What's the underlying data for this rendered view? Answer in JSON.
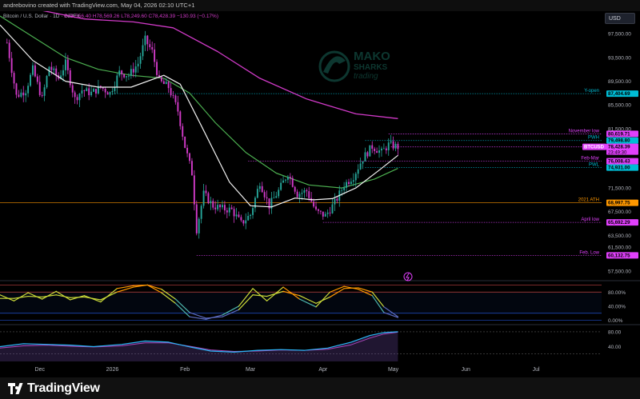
{
  "header": {
    "title": "andrebovino created with TradingView.com, May 04, 2026 02:10 UTC+1",
    "symbol_line": "Bitcoin / U.S. Dollar · 1D · INDEX",
    "ohlc": "O78,556.40 H78,569.26 L78,249.60 C78,428.39 −130.93 (−0.17%)"
  },
  "currency_button": "USD",
  "footer": {
    "brand": "TradingView"
  },
  "watermark": {
    "line1": "MAKO",
    "line2": "SHARKS",
    "line3": "trading"
  },
  "colors": {
    "up": "#26a69a",
    "down": "#d13ac8",
    "sma_fast": "#f2f2f2",
    "sma_mid": "#4caf50",
    "sma_slow": "#d13ac8",
    "level_cyan": "#00bcd4",
    "level_magenta": "#e040fb",
    "level_orange": "#ff9800"
  },
  "chart_data": [
    {
      "type": "candlestick",
      "x_labels": [
        "Dec",
        "2026",
        "Feb",
        "Mar",
        "Apr",
        "May",
        "Jun",
        "Jul"
      ],
      "x_label_dates": [
        "2025-12-01",
        "2026-01-01",
        "2026-02-01",
        "2026-03-01",
        "2026-04-01",
        "2026-05-01",
        "2026-06-01",
        "2026-07-01"
      ],
      "x_range": [
        "2025-11-14",
        "2026-07-29"
      ],
      "ylim": [
        56000,
        100500
      ],
      "y_ticks": [
        "97,500.00",
        "93,500.00",
        "89,500.00",
        "85,500.00",
        "81,500.00",
        "77,500.00",
        "75,500.00",
        "71,500.00",
        "67,500.00",
        "63,500.00",
        "61,500.00",
        "57,500.00"
      ],
      "y_tick_values": [
        97500,
        93500,
        89500,
        85500,
        81500,
        77500,
        75500,
        71500,
        67500,
        63500,
        61500,
        57500
      ],
      "price_path": [
        [
          "2025-11-17",
          96000
        ],
        [
          "2025-11-21",
          87000
        ],
        [
          "2025-11-25",
          88000
        ],
        [
          "2025-11-28",
          91500
        ],
        [
          "2025-12-02",
          86500
        ],
        [
          "2025-12-05",
          92000
        ],
        [
          "2025-12-09",
          90000
        ],
        [
          "2025-12-12",
          92500
        ],
        [
          "2025-12-16",
          86500
        ],
        [
          "2025-12-19",
          88000
        ],
        [
          "2025-12-23",
          87500
        ],
        [
          "2025-12-27",
          88500
        ],
        [
          "2025-12-31",
          87500
        ],
        [
          "2026-01-04",
          91000
        ],
        [
          "2026-01-08",
          90500
        ],
        [
          "2026-01-12",
          92500
        ],
        [
          "2026-01-15",
          96500
        ],
        [
          "2026-01-18",
          94500
        ],
        [
          "2026-01-21",
          89500
        ],
        [
          "2026-01-25",
          88500
        ],
        [
          "2026-01-29",
          84500
        ],
        [
          "2026-02-01",
          78500
        ],
        [
          "2026-02-04",
          74000
        ],
        [
          "2026-02-06",
          64500
        ],
        [
          "2026-02-09",
          70500
        ],
        [
          "2026-02-13",
          68500
        ],
        [
          "2026-02-17",
          68000
        ],
        [
          "2026-02-21",
          67800
        ],
        [
          "2026-02-25",
          65500
        ],
        [
          "2026-03-01",
          67000
        ],
        [
          "2026-03-05",
          72500
        ],
        [
          "2026-03-09",
          68500
        ],
        [
          "2026-03-13",
          71000
        ],
        [
          "2026-03-17",
          74000
        ],
        [
          "2026-03-21",
          70500
        ],
        [
          "2026-03-25",
          71000
        ],
        [
          "2026-03-29",
          67500
        ],
        [
          "2026-04-02",
          66800
        ],
        [
          "2026-04-06",
          69000
        ],
        [
          "2026-04-10",
          72000
        ],
        [
          "2026-04-14",
          73500
        ],
        [
          "2026-04-18",
          76500
        ],
        [
          "2026-04-22",
          78500
        ],
        [
          "2026-04-26",
          77500
        ],
        [
          "2026-04-29",
          78800
        ],
        [
          "2026-05-03",
          78428
        ]
      ],
      "sma_fast": [
        [
          "2025-11-14",
          99000
        ],
        [
          "2025-11-28",
          93000
        ],
        [
          "2025-12-12",
          89500
        ],
        [
          "2025-12-26",
          88500
        ],
        [
          "2026-01-09",
          88500
        ],
        [
          "2026-01-23",
          90500
        ],
        [
          "2026-01-30",
          89000
        ],
        [
          "2026-02-08",
          82000
        ],
        [
          "2026-02-20",
          72500
        ],
        [
          "2026-03-01",
          68500
        ],
        [
          "2026-03-10",
          68300
        ],
        [
          "2026-03-20",
          69800
        ],
        [
          "2026-03-28",
          69500
        ],
        [
          "2026-04-05",
          69700
        ],
        [
          "2026-04-15",
          71500
        ],
        [
          "2026-04-25",
          74500
        ],
        [
          "2026-05-03",
          77000
        ]
      ],
      "sma_mid": [
        [
          "2025-11-14",
          100500
        ],
        [
          "2025-11-28",
          97000
        ],
        [
          "2025-12-12",
          93500
        ],
        [
          "2025-12-26",
          91500
        ],
        [
          "2026-01-09",
          90500
        ],
        [
          "2026-01-23",
          90000
        ],
        [
          "2026-02-03",
          87500
        ],
        [
          "2026-02-14",
          82500
        ],
        [
          "2026-02-27",
          77500
        ],
        [
          "2026-03-12",
          74000
        ],
        [
          "2026-03-26",
          72000
        ],
        [
          "2026-04-09",
          71500
        ],
        [
          "2026-04-23",
          73000
        ],
        [
          "2026-05-03",
          74800
        ]
      ],
      "sma_slow": [
        [
          "2025-11-14",
          104500
        ],
        [
          "2025-12-01",
          101500
        ],
        [
          "2025-12-20",
          100000
        ],
        [
          "2026-01-10",
          99500
        ],
        [
          "2026-01-27",
          98500
        ],
        [
          "2026-02-15",
          94500
        ],
        [
          "2026-03-05",
          90000
        ],
        [
          "2026-03-25",
          86500
        ],
        [
          "2026-04-15",
          84000
        ],
        [
          "2026-05-03",
          83200
        ]
      ],
      "levels": [
        {
          "label": "Y-open",
          "value": 87404.69,
          "price": "87,404.69",
          "color": "#00bcd4",
          "from": "2026-01-01",
          "style": "dotted"
        },
        {
          "label": "November low",
          "value": 80619.71,
          "price": "80,619.71",
          "color": "#e040fb",
          "from": "2026-04-29",
          "style": "dotted"
        },
        {
          "label": "PWH",
          "value": 79498.8,
          "price": "79,498.80",
          "color": "#00bcd4",
          "from": "2026-04-19",
          "style": "dotted"
        },
        {
          "label": "BTCUSD",
          "value": 78428.39,
          "price": "78,428.39",
          "time": "23:49:30",
          "color": "#e040fb",
          "from": "2026-04-30",
          "style": "dotted"
        },
        {
          "label": "Feb-Mar",
          "value": 76008.43,
          "price": "76,008.43",
          "color": "#e040fb",
          "from": "2026-02-28",
          "style": "dotted"
        },
        {
          "label": "PWL",
          "value": 74931.0,
          "price": "74,931.00",
          "color": "#00bcd4",
          "from": "2026-04-19",
          "style": "dotted"
        },
        {
          "label": "2021 ATH",
          "value": 68997.75,
          "price": "68,997.75",
          "color": "#ff9800",
          "from": "2025-11-14",
          "style": "solid"
        },
        {
          "label": "April low",
          "value": 65692.29,
          "price": "65,692.29",
          "color": "#e040fb",
          "from": "2026-04-01",
          "style": "dotted"
        },
        {
          "label": "Feb. Low",
          "value": 60132.75,
          "price": "60,132.75",
          "color": "#e040fb",
          "from": "2026-02-06",
          "style": "dotted"
        }
      ]
    },
    {
      "type": "line",
      "name": "oscillator-1",
      "ylim": [
        -10,
        110
      ],
      "y_ticks": [
        "80.00%",
        "40.00%",
        "0.00%"
      ],
      "y_tick_values": [
        80,
        40,
        0
      ],
      "levels": [
        100,
        80,
        20,
        0
      ],
      "series_a": [
        [
          "2025-11-14",
          72
        ],
        [
          "2025-11-20",
          55
        ],
        [
          "2025-11-26",
          78
        ],
        [
          "2025-12-02",
          60
        ],
        [
          "2025-12-08",
          82
        ],
        [
          "2025-12-14",
          58
        ],
        [
          "2025-12-20",
          70
        ],
        [
          "2025-12-27",
          52
        ],
        [
          "2026-01-03",
          90
        ],
        [
          "2026-01-10",
          98
        ],
        [
          "2026-01-16",
          100
        ],
        [
          "2026-01-22",
          78
        ],
        [
          "2026-01-28",
          48
        ],
        [
          "2026-02-03",
          10
        ],
        [
          "2026-02-10",
          3
        ],
        [
          "2026-02-17",
          15
        ],
        [
          "2026-02-24",
          40
        ],
        [
          "2026-03-02",
          90
        ],
        [
          "2026-03-08",
          55
        ],
        [
          "2026-03-15",
          94
        ],
        [
          "2026-03-22",
          60
        ],
        [
          "2026-03-29",
          38
        ],
        [
          "2026-04-04",
          80
        ],
        [
          "2026-04-10",
          96
        ],
        [
          "2026-04-16",
          88
        ],
        [
          "2026-04-22",
          70
        ],
        [
          "2026-04-27",
          22
        ],
        [
          "2026-05-03",
          8
        ]
      ],
      "series_b": [
        [
          "2025-11-14",
          62
        ],
        [
          "2025-11-20",
          62
        ],
        [
          "2025-11-26",
          68
        ],
        [
          "2025-12-02",
          66
        ],
        [
          "2025-12-08",
          72
        ],
        [
          "2025-12-14",
          64
        ],
        [
          "2025-12-20",
          66
        ],
        [
          "2025-12-27",
          58
        ],
        [
          "2026-01-03",
          80
        ],
        [
          "2026-01-10",
          94
        ],
        [
          "2026-01-16",
          100
        ],
        [
          "2026-01-22",
          88
        ],
        [
          "2026-01-28",
          60
        ],
        [
          "2026-02-03",
          22
        ],
        [
          "2026-02-10",
          6
        ],
        [
          "2026-02-17",
          10
        ],
        [
          "2026-02-24",
          30
        ],
        [
          "2026-03-02",
          72
        ],
        [
          "2026-03-08",
          68
        ],
        [
          "2026-03-15",
          82
        ],
        [
          "2026-03-22",
          70
        ],
        [
          "2026-03-29",
          48
        ],
        [
          "2026-04-04",
          66
        ],
        [
          "2026-04-10",
          90
        ],
        [
          "2026-04-16",
          92
        ],
        [
          "2026-04-22",
          80
        ],
        [
          "2026-04-27",
          38
        ],
        [
          "2026-05-03",
          10
        ]
      ]
    },
    {
      "type": "line",
      "name": "oscillator-2",
      "ylim": [
        0,
        95
      ],
      "y_ticks": [
        "80.00",
        "40.00"
      ],
      "y_tick_values": [
        80,
        40
      ],
      "levels": [
        80,
        20
      ],
      "series_a": [
        [
          "2025-11-14",
          40
        ],
        [
          "2025-11-24",
          48
        ],
        [
          "2025-12-04",
          46
        ],
        [
          "2025-12-14",
          44
        ],
        [
          "2025-12-24",
          40
        ],
        [
          "2026-01-05",
          46
        ],
        [
          "2026-01-15",
          55
        ],
        [
          "2026-01-25",
          52
        ],
        [
          "2026-02-04",
          38
        ],
        [
          "2026-02-12",
          28
        ],
        [
          "2026-02-22",
          25
        ],
        [
          "2026-03-04",
          30
        ],
        [
          "2026-03-14",
          32
        ],
        [
          "2026-03-24",
          30
        ],
        [
          "2026-04-03",
          36
        ],
        [
          "2026-04-13",
          52
        ],
        [
          "2026-04-21",
          70
        ],
        [
          "2026-04-27",
          78
        ],
        [
          "2026-05-03",
          80
        ]
      ],
      "series_b": [
        [
          "2025-11-14",
          36
        ],
        [
          "2025-11-24",
          42
        ],
        [
          "2025-12-04",
          44
        ],
        [
          "2025-12-14",
          41
        ],
        [
          "2025-12-24",
          39
        ],
        [
          "2026-01-05",
          42
        ],
        [
          "2026-01-15",
          50
        ],
        [
          "2026-01-25",
          50
        ],
        [
          "2026-02-04",
          40
        ],
        [
          "2026-02-12",
          31
        ],
        [
          "2026-02-22",
          27
        ],
        [
          "2026-03-04",
          28
        ],
        [
          "2026-03-14",
          31
        ],
        [
          "2026-03-24",
          30
        ],
        [
          "2026-04-03",
          33
        ],
        [
          "2026-04-13",
          45
        ],
        [
          "2026-04-21",
          63
        ],
        [
          "2026-04-27",
          74
        ],
        [
          "2026-05-03",
          79
        ]
      ]
    }
  ]
}
